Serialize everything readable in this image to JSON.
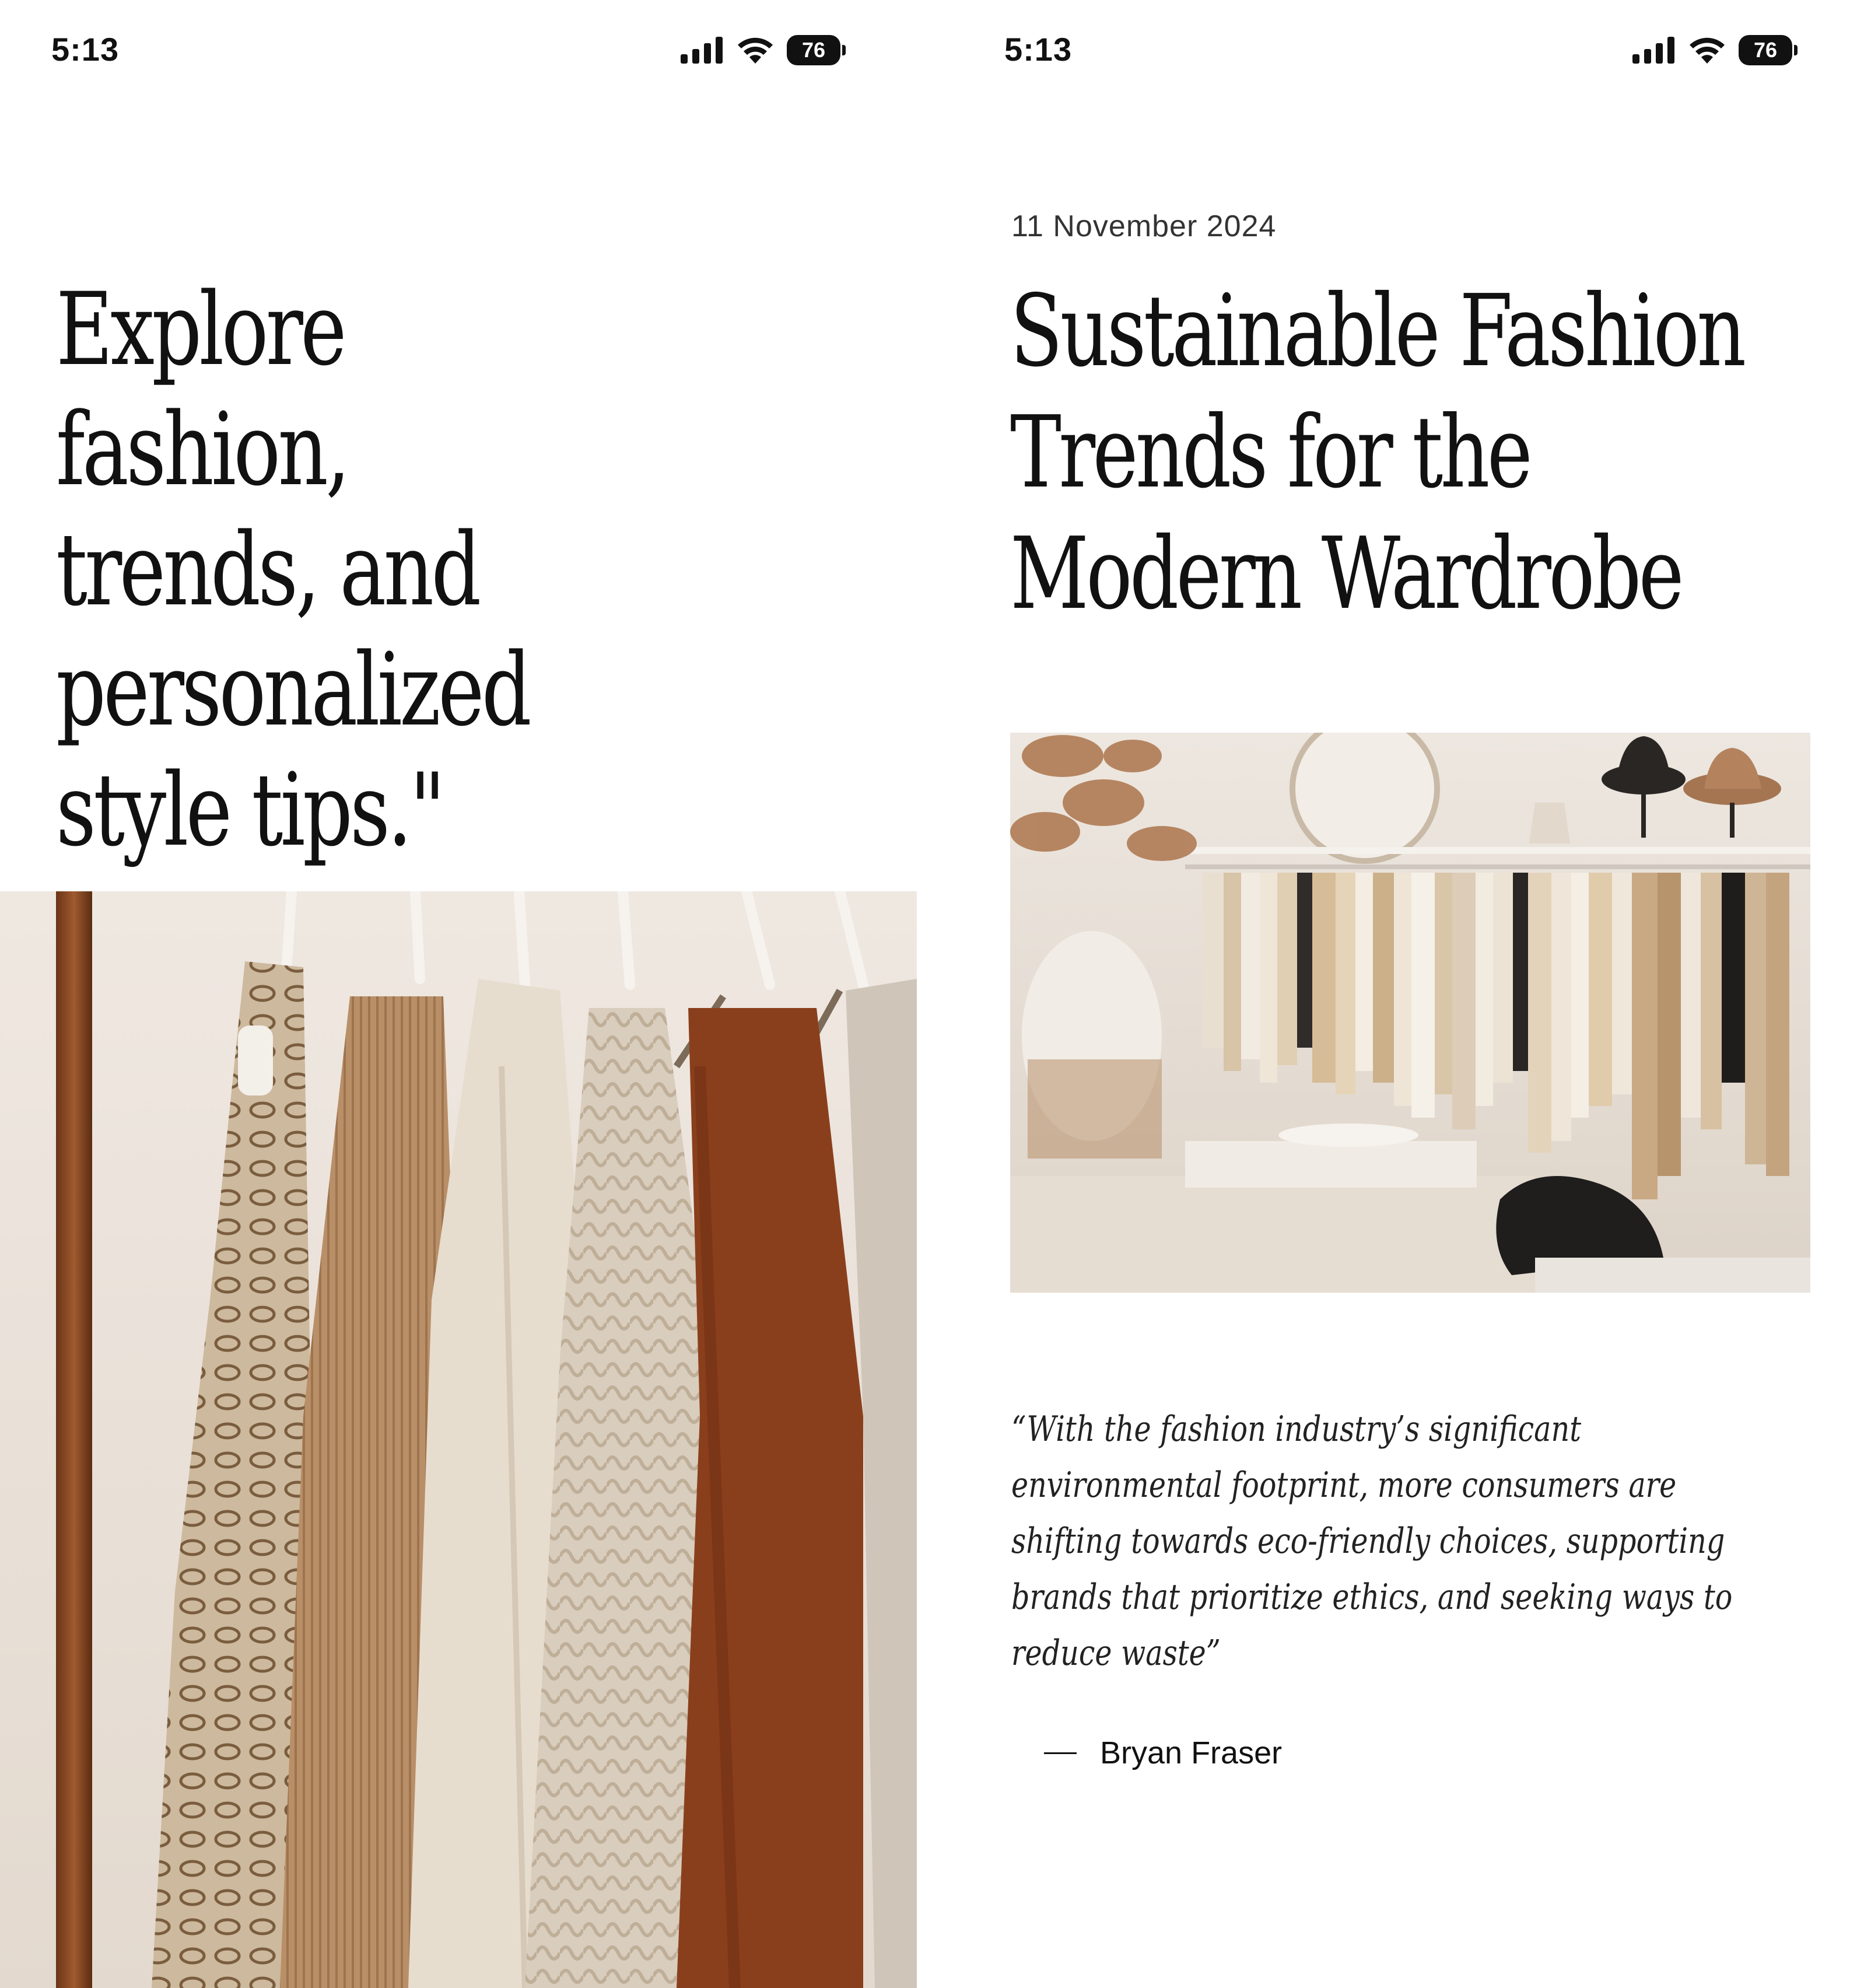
{
  "left_screen": {
    "status_bar": {
      "time": "5:13",
      "battery": "76",
      "icons": [
        "signal-icon",
        "wifi-icon",
        "battery-icon"
      ]
    },
    "headline_lines": [
      "Explore fashion,",
      "trends, and",
      "personalized",
      "style tips.\""
    ],
    "image": {
      "subject": "clothing-rack-photo"
    }
  },
  "right_screen": {
    "status_bar": {
      "time": "5:13",
      "battery": "76",
      "icons": [
        "signal-icon",
        "wifi-icon",
        "battery-icon"
      ]
    },
    "article": {
      "date": "11 November 2024",
      "title_lines": [
        "Sustainable Fashion",
        "Trends for the",
        "Modern Wardrobe"
      ],
      "image": {
        "subject": "boutique-interior-photo"
      },
      "quote_lines": [
        "“With the fashion industry’s significant",
        "environmental footprint, more consumers are",
        "shifting towards eco-friendly choices, supporting",
        "brands that prioritize ethics, and seeking ways to",
        "reduce waste”"
      ],
      "author": "Bryan Fraser"
    }
  },
  "colors": {
    "text": "#111111",
    "background": "#ffffff",
    "beige": "#d9c7b1",
    "rust": "#8a3f1c",
    "camel": "#b08a63",
    "cream": "#ece3d6"
  }
}
